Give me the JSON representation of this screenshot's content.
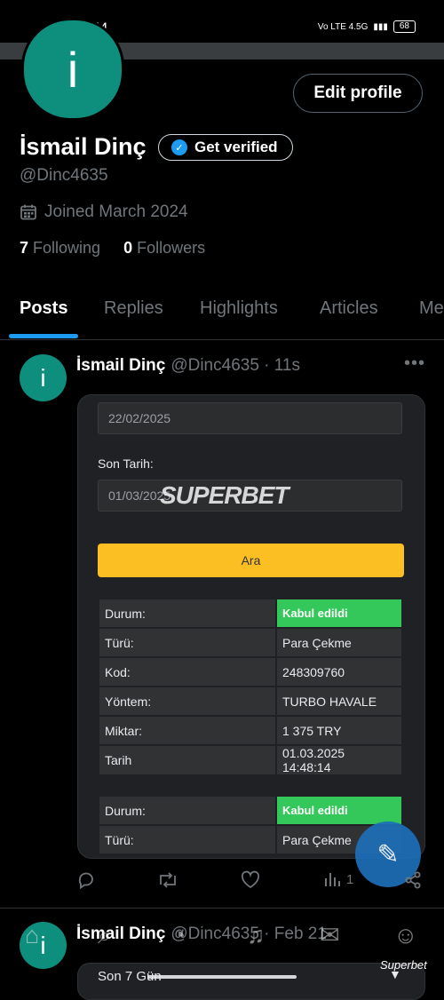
{
  "status_bar": {
    "time": "16:54",
    "network": "Vo LTE 4.5G",
    "battery": "68"
  },
  "profile": {
    "avatar_letter": "i",
    "edit_button": "Edit profile",
    "name": "İsmail Dinç",
    "verify_button": "Get verified",
    "handle": "@Dinc4635",
    "joined": "Joined March 2024",
    "following_count": "7",
    "following_label": "Following",
    "followers_count": "0",
    "followers_label": "Followers"
  },
  "tabs": [
    "Posts",
    "Replies",
    "Highlights",
    "Articles",
    "Me"
  ],
  "post": {
    "avatar_letter": "i",
    "author": "İsmail Dinç",
    "handle_time": "@Dinc4635 · 11s",
    "more": "•••",
    "media": {
      "date1": "22/02/2025",
      "end_label": "Son Tarih:",
      "date2": "01/03/2025",
      "logo": "SUPERBET",
      "search_button": "Ara",
      "rows1": [
        {
          "k": "Durum:",
          "v": "Kabul edildi",
          "ok": true
        },
        {
          "k": "Türü:",
          "v": "Para Çekme"
        },
        {
          "k": "Kod:",
          "v": "248309760"
        },
        {
          "k": "Yöntem:",
          "v": "TURBO HAVALE"
        },
        {
          "k": "Miktar:",
          "v": "1 375 TRY"
        },
        {
          "k": "Tarih",
          "v": "01.03.2025 14:48:14"
        }
      ],
      "rows2": [
        {
          "k": "Durum:",
          "v": "Kabul edildi",
          "ok": true
        },
        {
          "k": "Türü:",
          "v": "Para Çekme"
        }
      ]
    },
    "views": "1"
  },
  "post2": {
    "avatar_letter": "i",
    "author": "İsmail Dinç",
    "handle_time": "@Dinc4635 · Feb 21",
    "media_text": "Son 7 Gün"
  },
  "watermark": "Superbet",
  "icons": [
    "calendar-icon",
    "verified-icon",
    "reply-icon",
    "repost-icon",
    "like-icon",
    "views-icon",
    "share-icon",
    "compose-icon",
    "home-icon",
    "search-icon",
    "grok-icon",
    "notifications-icon",
    "messages-icon",
    "communities-icon"
  ]
}
